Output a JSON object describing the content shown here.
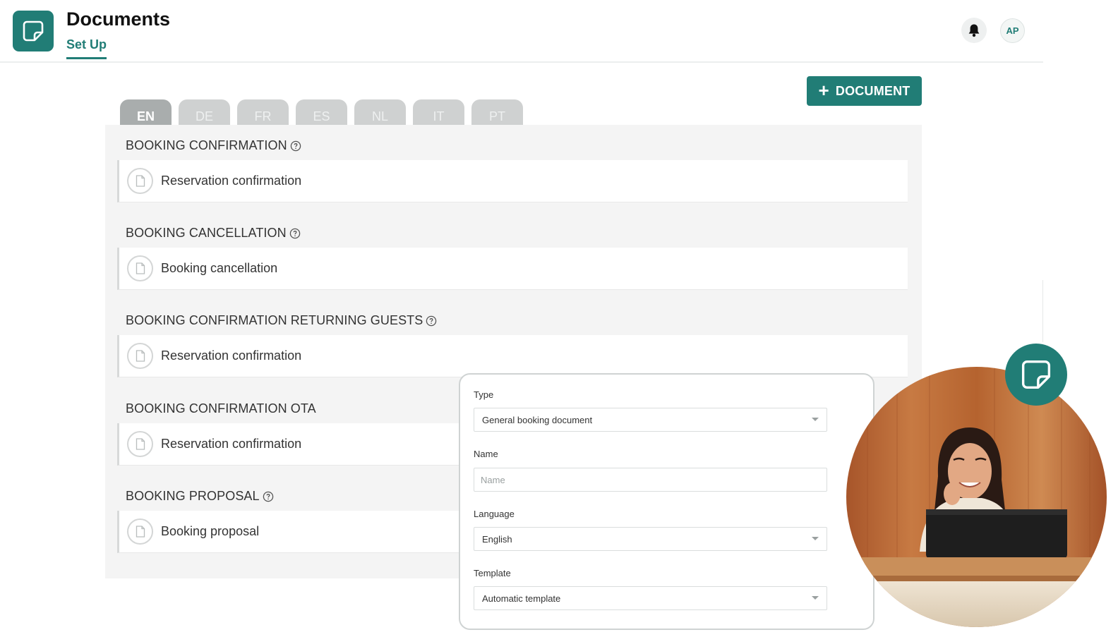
{
  "header": {
    "title": "Documents",
    "nav_tab": "Set Up",
    "avatar_initials": "AP",
    "app_icon": "sticky-note-icon",
    "bell_icon": "bell-icon"
  },
  "actions": {
    "add_document_label": "DOCUMENT",
    "add_document_icon": "plus-icon"
  },
  "languages": {
    "tabs": [
      "EN",
      "DE",
      "FR",
      "ES",
      "NL",
      "IT",
      "PT"
    ],
    "selected": "EN"
  },
  "sections": [
    {
      "title": "BOOKING CONFIRMATION",
      "has_help": true,
      "document": "Reservation confirmation"
    },
    {
      "title": "BOOKING CANCELLATION",
      "has_help": true,
      "document": "Booking cancellation"
    },
    {
      "title": "BOOKING CONFIRMATION RETURNING GUESTS",
      "has_help": true,
      "document": "Reservation confirmation"
    },
    {
      "title": "BOOKING CONFIRMATION OTA",
      "has_help": false,
      "document": "Reservation confirmation"
    },
    {
      "title": "BOOKING PROPOSAL",
      "has_help": true,
      "document": "Booking proposal"
    }
  ],
  "form": {
    "type_label": "Type",
    "type_value": "General booking document",
    "name_label": "Name",
    "name_placeholder": "Name",
    "language_label": "Language",
    "language_value": "English",
    "template_label": "Template",
    "template_value": "Automatic template"
  },
  "colors": {
    "brand": "#217d76",
    "panel_bg": "#f4f4f4",
    "tab_inactive": "#cfd1d1",
    "tab_active": "#a9adad"
  }
}
